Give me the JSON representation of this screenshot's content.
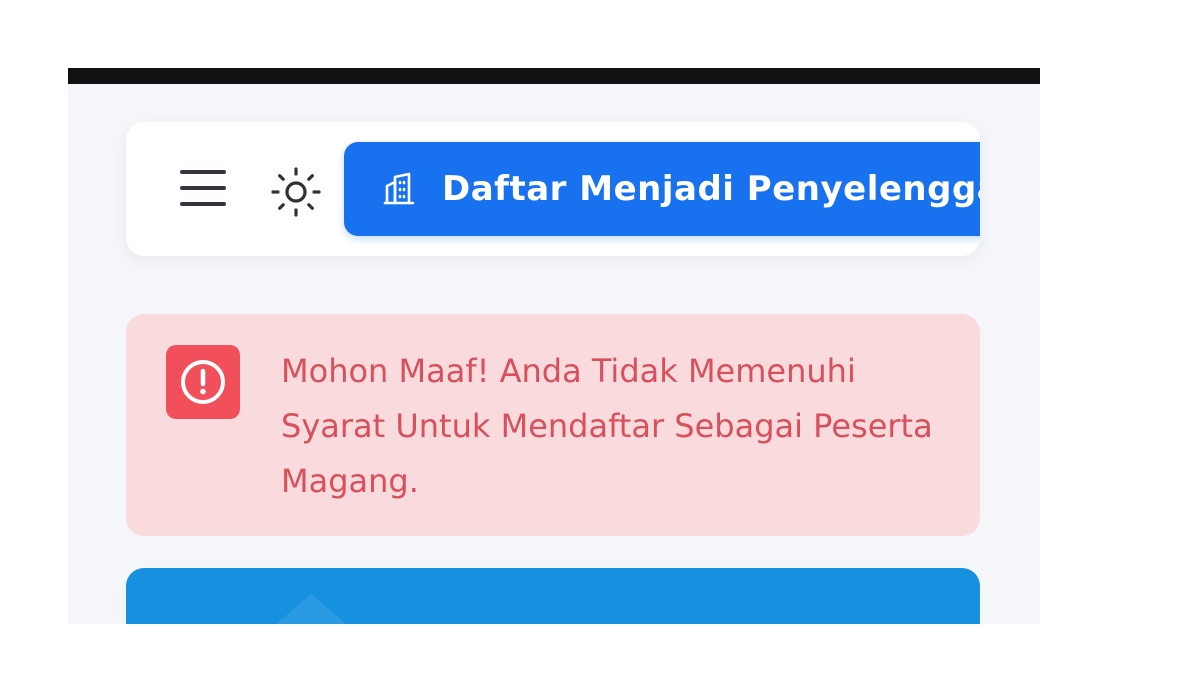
{
  "header": {
    "menu_icon": "hamburger-menu-icon",
    "theme_icon": "sun-icon",
    "register_button": {
      "icon": "building-icon",
      "label": "Daftar Menjadi Penyelenggara"
    }
  },
  "alert": {
    "icon": "exclamation-circle-icon",
    "message": "Mohon Maaf! Anda Tidak Memenuhi Syarat Untuk Mendaftar Sebagai Peserta Magang."
  },
  "colors": {
    "primary_button": "#1872f0",
    "alert_background": "#fadbdd",
    "alert_text": "#d94f5c",
    "alert_icon_background": "#f1505a",
    "info_card": "#1591e0",
    "page_background": "#f5f6fa"
  }
}
